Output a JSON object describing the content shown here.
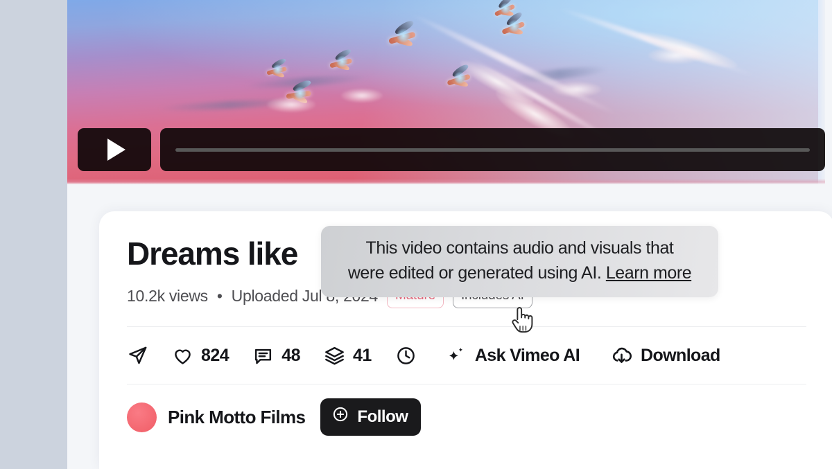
{
  "video": {
    "scene_description": "flamingos-flying-over-pink-lake",
    "play_button_label": "play-video",
    "progress_percent": 0
  },
  "card": {
    "title": "Dreams like",
    "meta": {
      "views": "10.2k views",
      "separator": "•",
      "upload": "Uploaded Jul 8, 2024"
    },
    "badges": [
      {
        "label": "Mature",
        "color": "#e8697d",
        "border": "#f2b9c3"
      },
      {
        "label": "Includes AI",
        "color": "#4e4e52",
        "border": "#9fa1a5"
      }
    ],
    "actions": [
      {
        "icon": "share-icon",
        "label": ""
      },
      {
        "icon": "heart-icon",
        "label": "824"
      },
      {
        "icon": "comment-icon",
        "label": "48"
      },
      {
        "icon": "collections-icon",
        "label": "41"
      },
      {
        "icon": "clock-icon",
        "label": ""
      },
      {
        "icon": "sparkle-icon",
        "label": "Ask Vimeo AI"
      },
      {
        "icon": "cloud-download-icon",
        "label": "Download"
      }
    ],
    "author": {
      "name": "Pink Motto Films",
      "avatar_color": "#f05d66",
      "follow_label": "Follow",
      "follow_icon": "plus-circle-icon"
    }
  },
  "tooltip": {
    "line1": "This video contains audio and visuals that",
    "line2_prefix": "were edited or generated using AI.",
    "link": "Learn more",
    "background": "#d9dadd"
  },
  "cursor": {
    "type": "pointing-hand-cursor"
  },
  "colors": {
    "page_background": "#f4f6f9",
    "gutter": "#ccd3de",
    "card": "#ffffff",
    "text_primary": "#15161a",
    "text_secondary": "#4e4e52",
    "accent_dark": "#1a1a1c"
  }
}
